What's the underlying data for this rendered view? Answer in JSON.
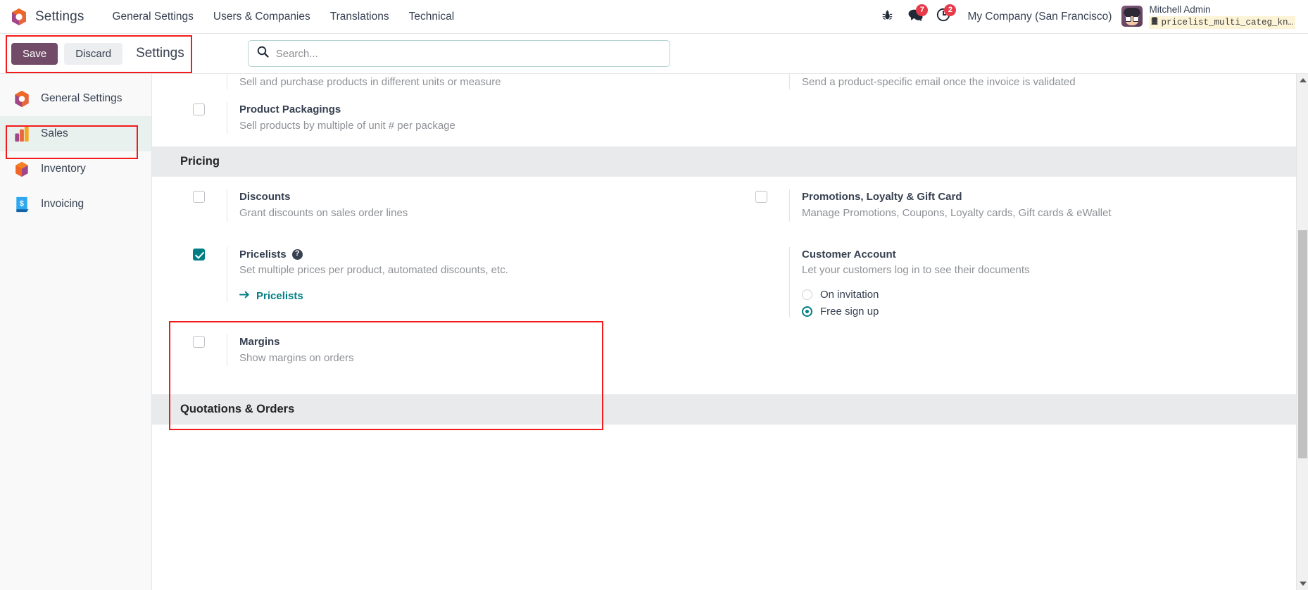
{
  "navbar": {
    "logo_icon": "odoo-logo-icon",
    "brand": "Settings",
    "menu": [
      {
        "label": "General Settings"
      },
      {
        "label": "Users & Companies"
      },
      {
        "label": "Translations"
      },
      {
        "label": "Technical"
      }
    ],
    "bug_icon": "bug-icon",
    "messages_icon": "messages-icon",
    "messages_count": "7",
    "activities_icon": "clock-activities-icon",
    "activities_count": "2",
    "company": "My Company (San Francisco)",
    "user_name": "Mitchell Admin",
    "database_icon": "database-icon",
    "database": "pricelist_multi_categ_kn…"
  },
  "control_panel": {
    "save_label": "Save",
    "discard_label": "Discard",
    "title": "Settings",
    "search_icon": "search-icon",
    "search_placeholder": "Search...",
    "search_value": ""
  },
  "sidebar": {
    "items": [
      {
        "label": "General Settings",
        "icon": "general-settings-app-icon",
        "active": false
      },
      {
        "label": "Sales",
        "icon": "sales-app-icon",
        "active": true
      },
      {
        "label": "Inventory",
        "icon": "inventory-app-icon",
        "active": false
      },
      {
        "label": "Invoicing",
        "icon": "invoicing-app-icon",
        "active": false
      }
    ]
  },
  "settings": {
    "clipped": {
      "left_desc": "Sell and purchase products in different units or measure",
      "right_desc": "Send a product-specific email once the invoice is validated"
    },
    "product_packagings": {
      "title": "Product Packagings",
      "desc": "Sell products by multiple of unit # per package",
      "checked": false
    },
    "pricing_section": "Pricing",
    "discounts": {
      "title": "Discounts",
      "desc": "Grant discounts on sales order lines",
      "checked": false
    },
    "promotions": {
      "title": "Promotions, Loyalty & Gift Card",
      "desc": "Manage Promotions, Coupons, Loyalty cards, Gift cards & eWallet",
      "checked": false
    },
    "pricelists": {
      "title": "Pricelists",
      "help_icon": "help-question-icon",
      "desc": "Set multiple prices per product, automated discounts, etc.",
      "link_icon": "arrow-right-icon",
      "link_label": "Pricelists",
      "checked": true
    },
    "customer_account": {
      "title": "Customer Account",
      "desc": "Let your customers log in to see their documents",
      "options": [
        {
          "label": "On invitation",
          "selected": false
        },
        {
          "label": "Free sign up",
          "selected": true
        }
      ]
    },
    "margins": {
      "title": "Margins",
      "desc": "Show margins on orders",
      "checked": false
    },
    "quotations_section": "Quotations & Orders"
  },
  "colors": {
    "primary": "#714b67",
    "accent": "#017e84",
    "badge": "#e6394a",
    "annotation": "#f21b1b"
  }
}
